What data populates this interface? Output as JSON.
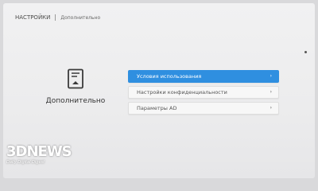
{
  "header": {
    "title": "НАСТРОЙКИ",
    "breadcrumb": "Дополнительно"
  },
  "left_pane": {
    "icon": "document-icon",
    "title": "Дополнительно"
  },
  "menu": {
    "items": [
      {
        "label": "Условия использования",
        "active": true
      },
      {
        "label": "Настройки конфиденциальности",
        "active": false
      },
      {
        "label": "Параметры AD",
        "active": false
      }
    ],
    "chevron": "›"
  },
  "colors": {
    "accent": "#2f8fe0",
    "background": "#ececed"
  },
  "watermark": {
    "logo": "3DNEWS",
    "tagline": "Daily Digital Digest"
  }
}
